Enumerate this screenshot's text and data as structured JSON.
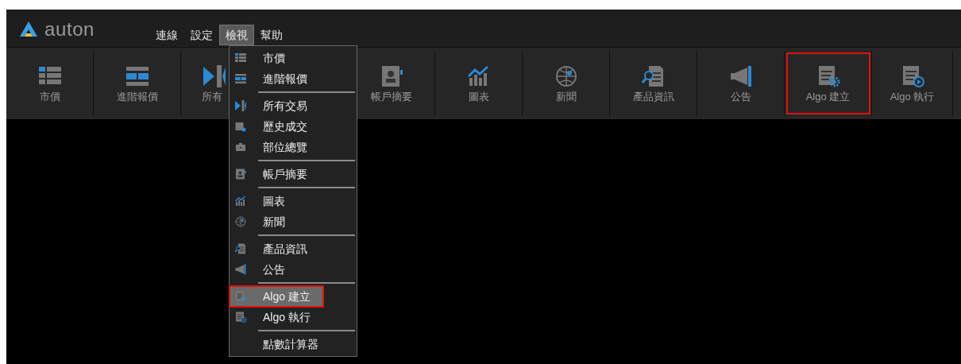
{
  "app": {
    "logo": "auton"
  },
  "menu_bar": [
    {
      "label": "連線",
      "selected": false
    },
    {
      "label": "設定",
      "selected": false
    },
    {
      "label": "檢視",
      "selected": true
    },
    {
      "label": "幫助",
      "selected": false
    }
  ],
  "toolbar": [
    {
      "label": "市價",
      "highlighted": false
    },
    {
      "label": "進階報價",
      "highlighted": false
    },
    {
      "label": "所有",
      "highlighted": false
    },
    {
      "label": "帳戶摘要",
      "highlighted": false
    },
    {
      "label": "圖表",
      "highlighted": false
    },
    {
      "label": "新聞",
      "highlighted": false
    },
    {
      "label": "產品資訊",
      "highlighted": false
    },
    {
      "label": "公告",
      "highlighted": false
    },
    {
      "label": "Algo 建立",
      "highlighted": true
    },
    {
      "label": "Algo 執行",
      "highlighted": false
    }
  ],
  "view_menu": [
    [
      {
        "label": "市價",
        "selected": false,
        "highlighted": false
      },
      {
        "label": "進階報價",
        "selected": false,
        "highlighted": false
      }
    ],
    [
      {
        "label": "所有交易",
        "selected": false,
        "highlighted": false
      },
      {
        "label": "歷史成交",
        "selected": false,
        "highlighted": false
      },
      {
        "label": "部位總覽",
        "selected": false,
        "highlighted": false
      }
    ],
    [
      {
        "label": "帳戶摘要",
        "selected": false,
        "highlighted": false
      }
    ],
    [
      {
        "label": "圖表",
        "selected": false,
        "highlighted": false
      },
      {
        "label": "新聞",
        "selected": false,
        "highlighted": false
      }
    ],
    [
      {
        "label": "產品資訊",
        "selected": false,
        "highlighted": false
      },
      {
        "label": "公告",
        "selected": false,
        "highlighted": false
      }
    ],
    [
      {
        "label": "Algo 建立",
        "selected": true,
        "highlighted": true
      },
      {
        "label": "Algo 執行",
        "selected": false,
        "highlighted": false
      }
    ],
    [
      {
        "label": "點數計算器",
        "selected": false,
        "highlighted": false
      }
    ]
  ]
}
